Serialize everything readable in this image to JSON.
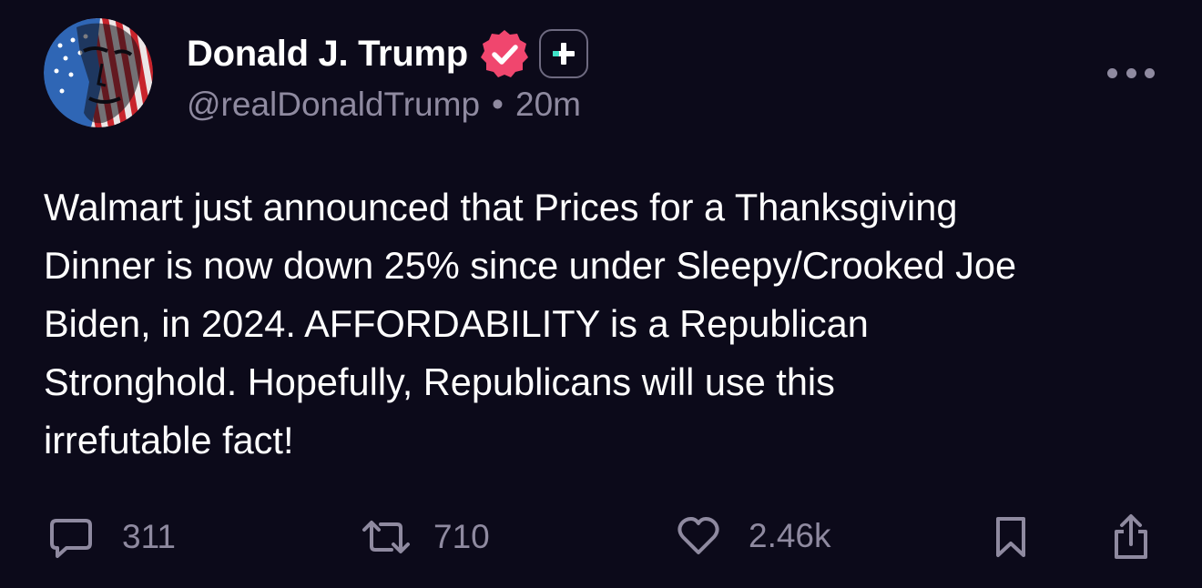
{
  "post": {
    "author": {
      "display_name": "Donald J. Trump",
      "handle": "@realDonaldTrump",
      "separator": "•",
      "time_ago": "20m"
    },
    "body": "Walmart just announced that Prices for a Thanksgiving\nDinner is now down 25% since under Sleepy/Crooked Joe\nBiden, in 2024. AFFORDABILITY is a Republican\nStronghold. Hopefully, Republicans will use this\nirrefutable fact!",
    "actions": {
      "replies": "311",
      "reposts": "710",
      "likes": "2.46k"
    }
  },
  "icons": {
    "avatar": "avatar-flag-portrait",
    "verified": "verified-badge-icon",
    "plus": "plus-subscription-badge-icon",
    "more": "more-horizontal-icon",
    "reply": "comment-icon",
    "repost": "repost-icon",
    "like": "heart-icon",
    "bookmark": "bookmark-icon",
    "share": "share-icon"
  },
  "colors": {
    "background": "#0c0a1a",
    "text_primary": "#ffffff",
    "text_secondary": "#8f8aa0",
    "verified_pink": "#f0466e",
    "plus_teal": "#3ee3c8"
  }
}
